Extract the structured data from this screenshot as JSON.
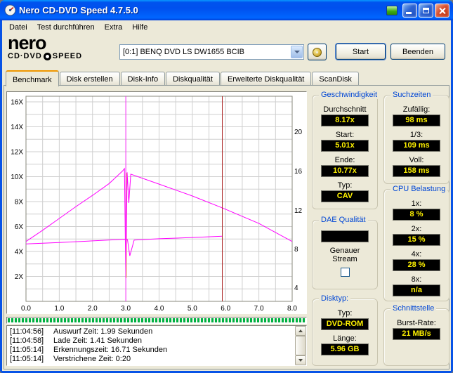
{
  "window": {
    "title": "Nero CD-DVD Speed 4.7.5.0"
  },
  "menu": {
    "items": [
      "Datei",
      "Test durchführen",
      "Extra",
      "Hilfe"
    ]
  },
  "logo": {
    "name": "nero",
    "tagline_left": "CD·DVD",
    "tagline_right": "SPEED"
  },
  "toolbar": {
    "drive": "[0:1]   BENQ DVD LS DW1655 BCIB",
    "start": "Start",
    "quit": "Beenden"
  },
  "tabs": [
    {
      "label": "Benchmark"
    },
    {
      "label": "Disk erstellen"
    },
    {
      "label": "Disk-Info"
    },
    {
      "label": "Diskqualität"
    },
    {
      "label": "Erweiterte Diskqualität"
    },
    {
      "label": "ScanDisk"
    }
  ],
  "chart_data": {
    "type": "line",
    "title": "",
    "x_axis": {
      "min": 0,
      "max": 8,
      "tick_values": [
        0,
        1,
        2,
        3,
        4,
        5,
        6,
        7,
        8
      ],
      "tick_labels": [
        "0.0",
        "1.0",
        "2.0",
        "3.0",
        "4.0",
        "5.0",
        "6.0",
        "7.0",
        "8.0"
      ]
    },
    "y_left": {
      "min": 0,
      "max": 16.45,
      "tick_values": [
        2,
        4,
        6,
        8,
        10,
        12,
        14,
        16
      ],
      "tick_labels": [
        "2X",
        "4X",
        "6X",
        "8X",
        "10X",
        "12X",
        "14X",
        "16X"
      ]
    },
    "y_right": {
      "ticks": [
        {
          "label": "20",
          "pos": 13.6
        },
        {
          "label": "16",
          "pos": 10.45
        },
        {
          "label": "12",
          "pos": 7.3
        },
        {
          "label": "8",
          "pos": 4.2
        },
        {
          "label": "4",
          "pos": 1.1
        }
      ]
    },
    "grid": {
      "color": "#CFCFCF",
      "x_step": 0.5,
      "y_step": 1
    },
    "series": [
      {
        "name": "read-speed-curve",
        "color": "#FF00FF",
        "points": [
          [
            0,
            4.8
          ],
          [
            0.5,
            5.7
          ],
          [
            1,
            6.65
          ],
          [
            1.5,
            7.6
          ],
          [
            2,
            8.5
          ],
          [
            2.5,
            9.45
          ],
          [
            2.9,
            10.45
          ],
          [
            2.96,
            10.65
          ],
          [
            3.0,
            1.85
          ],
          [
            3.04,
            10.35
          ],
          [
            3.09,
            7.9
          ],
          [
            3.15,
            10.2
          ],
          [
            4,
            9.4
          ],
          [
            5,
            8.45
          ],
          [
            5.9,
            7.5
          ],
          [
            7,
            6.25
          ],
          [
            8,
            4.8
          ]
        ]
      },
      {
        "name": "rotation-speed-curve",
        "color": "#FF00FF",
        "points": [
          [
            0,
            4.6
          ],
          [
            1,
            4.72
          ],
          [
            2,
            4.85
          ],
          [
            2.95,
            4.98
          ],
          [
            3.05,
            4.95
          ],
          [
            3.12,
            3.65
          ],
          [
            3.25,
            4.92
          ],
          [
            4,
            5.02
          ],
          [
            5,
            5.12
          ],
          [
            5.9,
            5.22
          ]
        ]
      }
    ],
    "markers": [
      {
        "name": "spike-highlight",
        "x": 3.02,
        "color": "#E8E23C",
        "y1": 1.9,
        "y2": 10.3,
        "layer": "under"
      },
      {
        "name": "position-cursor",
        "x": 3.0,
        "color": "#FF2BFF",
        "layer": "over"
      },
      {
        "name": "disc-end-marker",
        "x": 5.9,
        "color": "#AA2222",
        "layer": "over"
      }
    ]
  },
  "log": {
    "lines": [
      {
        "time": "[11:04:56]",
        "text": "Auswurf Zeit: 1.99 Sekunden"
      },
      {
        "time": "[11:04:58]",
        "text": "Lade Zeit: 1.41 Sekunden"
      },
      {
        "time": "[11:05:14]",
        "text": "Erkennungszeit: 16.71 Sekunden"
      },
      {
        "time": "[11:05:14]",
        "text": "Verstrichene Zeit: 0:20"
      }
    ]
  },
  "panels": {
    "speed": {
      "title": "Geschwindigkeit",
      "rows": [
        {
          "label": "Durchschnitt",
          "value": "8.17x"
        },
        {
          "label": "Start:",
          "value": "5.01x"
        },
        {
          "label": "Ende:",
          "value": "10.77x"
        },
        {
          "label": "Typ:",
          "value": "CAV"
        }
      ]
    },
    "dae": {
      "title": "DAE Qualität",
      "value": "",
      "stream_label": "Genauer Stream"
    },
    "disc": {
      "title": "Disktyp:",
      "rows": [
        {
          "label": "Typ:",
          "value": "DVD-ROM"
        },
        {
          "label": "Länge:",
          "value": "5.96 GB"
        }
      ]
    },
    "seek": {
      "title": "Suchzeiten",
      "rows": [
        {
          "label": "Zufällig:",
          "value": "98 ms"
        },
        {
          "label": "1/3:",
          "value": "109 ms"
        },
        {
          "label": "Voll:",
          "value": "158 ms"
        }
      ]
    },
    "cpu": {
      "title": "CPU Belastung",
      "rows": [
        {
          "label": "1x:",
          "value": "8 %"
        },
        {
          "label": "2x:",
          "value": "15 %"
        },
        {
          "label": "4x:",
          "value": "28 %"
        },
        {
          "label": "8x:",
          "value": "n/a"
        }
      ]
    },
    "iface": {
      "title": "Schnittstelle",
      "rows": [
        {
          "label": "Burst-Rate:",
          "value": "21 MB/s"
        }
      ]
    }
  },
  "colors": {
    "accent_blue": "#0046D5",
    "value_yellow": "#FFF200",
    "curve_magenta": "#FF00FF",
    "marker_red": "#AA2222"
  }
}
